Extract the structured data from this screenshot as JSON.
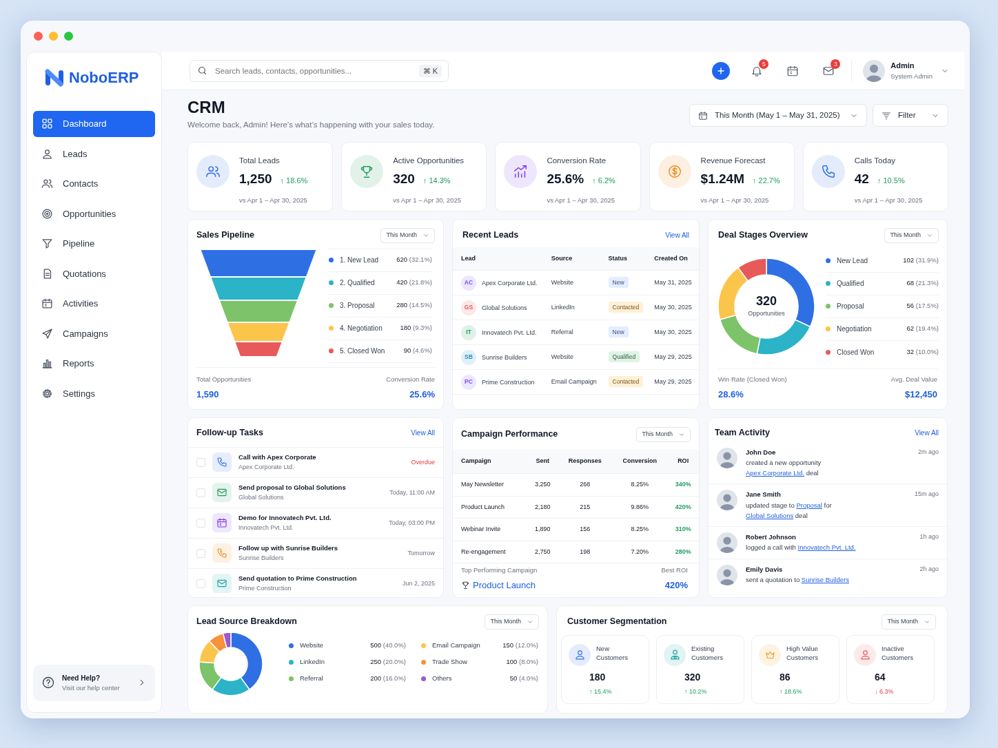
{
  "brand": {
    "name": "NoboERP"
  },
  "sidebar": {
    "items": [
      {
        "label": "Dashboard",
        "selected": true
      },
      {
        "label": "Leads",
        "selected": false
      },
      {
        "label": "Contacts",
        "selected": false
      },
      {
        "label": "Opportunities",
        "selected": false
      },
      {
        "label": "Pipeline",
        "selected": false
      },
      {
        "label": "Quotations",
        "selected": false
      },
      {
        "label": "Activities",
        "selected": false
      },
      {
        "label": "Campaigns",
        "selected": false
      },
      {
        "label": "Reports",
        "selected": false
      },
      {
        "label": "Settings",
        "selected": false
      }
    ],
    "help": {
      "title": "Need Help?",
      "subtitle": "Visit our help center"
    }
  },
  "search": {
    "placeholder": "Search leads, contacts, opportunities...",
    "shortcut": "⌘ K"
  },
  "header": {
    "notifications": "5",
    "messages": "3",
    "user": {
      "name": "Admin",
      "role": "System Admin"
    }
  },
  "page": {
    "title": "CRM",
    "subtitle": "Welcome back, Admin! Here’s what’s happening with your sales today.",
    "date_range": "This Month (May 1 – May 31, 2025)",
    "filter": "Filter"
  },
  "kpis": [
    {
      "label": "Total Leads",
      "value": "1,250",
      "change": "↑ 18.6%",
      "down": false,
      "period": "vs Apr 1 – Apr 30, 2025",
      "color": "#2f6fe4"
    },
    {
      "label": "Active Opportunities",
      "value": "320",
      "change": "↑ 14.3%",
      "down": false,
      "period": "vs Apr 1 – Apr 30, 2025",
      "color": "#1f9d5c"
    },
    {
      "label": "Conversion Rate",
      "value": "25.6%",
      "change": "↑ 6.2%",
      "down": false,
      "period": "vs Apr 1 – Apr 30, 2025",
      "color": "#7c3aed"
    },
    {
      "label": "Revenue Forecast",
      "value": "$1.24M",
      "change": "↑ 22.7%",
      "down": false,
      "period": "vs Apr 1 – Apr 30, 2025",
      "color": "#f08c1a"
    },
    {
      "label": "Calls Today",
      "value": "42",
      "change": "↑ 10.5%",
      "down": false,
      "period": "vs Apr 1 – Apr 30, 2025",
      "color": "#2f6fe4"
    }
  ],
  "sales_pipeline": {
    "title": "Sales Pipeline",
    "period": "This Month",
    "stages": [
      {
        "label": "1. New Lead",
        "value": "620",
        "share": "(32.1%)",
        "color": "#2f6fe4"
      },
      {
        "label": "2. Qualified",
        "value": "420",
        "share": "(21.8%)",
        "color": "#2bb3c8"
      },
      {
        "label": "3. Proposal",
        "value": "280",
        "share": "(14.5%)",
        "color": "#7cc36a"
      },
      {
        "label": "4. Negotiation",
        "value": "180",
        "share": "(9.3%)",
        "color": "#fbc54c"
      },
      {
        "label": "5. Closed Won",
        "value": "90",
        "share": "(4.6%)",
        "color": "#e85a5a"
      }
    ],
    "total_label": "Total Opportunities",
    "total": "1,590",
    "rate_label": "Conversion Rate",
    "rate": "25.6%"
  },
  "recent_leads": {
    "title": "Recent Leads",
    "view_all": "View All",
    "columns": [
      "Lead",
      "Source",
      "Status",
      "Created On"
    ],
    "rows": [
      {
        "initials": "AC",
        "color": "#7c4dff",
        "lead": "Apex Corporate Ltd.",
        "source": "Website",
        "status": {
          "label": "New",
          "color": "#e3edff"
        },
        "created": "May 31, 2025"
      },
      {
        "initials": "GS",
        "color": "#e85a5a",
        "lead": "Global Solutions",
        "source": "LinkedIn",
        "status": {
          "label": "Contacted",
          "color": "#fdf0d5"
        },
        "created": "May 30, 2025"
      },
      {
        "initials": "IT",
        "color": "#1f9d5c",
        "lead": "Innovatech Pvt. Ltd.",
        "source": "Referral",
        "status": {
          "label": "New",
          "color": "#e3edff"
        },
        "created": "May 30, 2025"
      },
      {
        "initials": "SB",
        "color": "#2a8fc8",
        "lead": "Sunrise Builders",
        "source": "Website",
        "status": {
          "label": "Qualified",
          "color": "#dff3e6"
        },
        "created": "May 29, 2025"
      },
      {
        "initials": "PC",
        "color": "#7c4dff",
        "lead": "Prime Construction",
        "source": "Email Campaign",
        "status": {
          "label": "Contacted",
          "color": "#fdf0d5"
        },
        "created": "May 29, 2025"
      }
    ]
  },
  "deal_stages": {
    "title": "Deal Stages Overview",
    "period": "This Month",
    "center_value": "320",
    "center_label": "Opportunities",
    "chart_data": {
      "type": "donut",
      "values": [
        31.9,
        21.3,
        17.5,
        19.4,
        10.0
      ]
    },
    "legend": [
      {
        "label": "New Lead",
        "value": "102",
        "share": "(31.9%)",
        "color": "#2f6fe4"
      },
      {
        "label": "Qualified",
        "value": "68",
        "share": "(21.3%)",
        "color": "#2bb3c8"
      },
      {
        "label": "Proposal",
        "value": "56",
        "share": "(17.5%)",
        "color": "#7cc36a"
      },
      {
        "label": "Negotiation",
        "value": "62",
        "share": "(19.4%)",
        "color": "#fbc54c"
      },
      {
        "label": "Closed Won",
        "value": "32",
        "share": "(10.0%)",
        "color": "#e85a5a"
      }
    ],
    "win_label": "Win Rate (Closed Won)",
    "win": "28.6%",
    "avg_label": "Avg. Deal Value",
    "avg": "$12,450"
  },
  "tasks": {
    "title": "Follow-up Tasks",
    "view_all": "View All",
    "items": [
      {
        "kind": "call",
        "title": "Call with Apex Corporate",
        "company": "Apex Corporate Ltd.",
        "due": "Overdue",
        "overdue": true,
        "checked": false,
        "color": "#2f6fe4"
      },
      {
        "kind": "email",
        "title": "Send proposal to Global Solutions",
        "company": "Global Solutions",
        "due": "Today, 11:00 AM",
        "overdue": false,
        "checked": false,
        "color": "#1f9d5c"
      },
      {
        "kind": "meeting",
        "title": "Demo for Innovatech Pvt. Ltd.",
        "company": "Innovatech Pvt. Ltd.",
        "due": "Today, 03:00 PM",
        "overdue": false,
        "checked": false,
        "color": "#7c3aed"
      },
      {
        "kind": "call",
        "title": "Follow up with Sunrise Builders",
        "company": "Sunrise Builders",
        "due": "Tomorrow",
        "overdue": false,
        "checked": false,
        "color": "#f08c1a"
      },
      {
        "kind": "email",
        "title": "Send quotation to Prime Construction",
        "company": "Prime Construction",
        "due": "Jun 2, 2025",
        "overdue": false,
        "checked": false,
        "color": "#1aa3a3"
      }
    ]
  },
  "campaigns": {
    "title": "Campaign Performance",
    "period": "This Month",
    "columns": [
      "Campaign",
      "Sent",
      "Responses",
      "Conversion",
      "ROI"
    ],
    "rows": [
      [
        "May Newsletter",
        "3,250",
        "268",
        "8.25%",
        "340%"
      ],
      [
        "Product Launch",
        "2,180",
        "215",
        "9.86%",
        "420%"
      ],
      [
        "Webinar Invite",
        "1,890",
        "156",
        "8.25%",
        "310%"
      ],
      [
        "Re-engagement",
        "2,750",
        "198",
        "7.20%",
        "280%"
      ]
    ],
    "top_label": "Top Performing Campaign",
    "top": "Product Launch",
    "roi_label": "Best ROI",
    "roi": "420%"
  },
  "team": {
    "title": "Team Activity",
    "view_all": "View All",
    "items": [
      {
        "name": "John Doe",
        "time": "2m ago",
        "parts": [
          {
            "text": "created a new opportunity ",
            "link": false
          },
          {
            "text": "Apex Corporate Ltd.",
            "link": true
          },
          {
            "text": " deal",
            "link": false
          }
        ]
      },
      {
        "name": "Jane Smith",
        "time": "15m ago",
        "parts": [
          {
            "text": "updated stage to ",
            "link": false
          },
          {
            "text": "Proposal",
            "link": true
          },
          {
            "text": " for ",
            "link": false
          },
          {
            "text": "Global Solutions",
            "link": true
          },
          {
            "text": " deal",
            "link": false
          }
        ]
      },
      {
        "name": "Robert Johnson",
        "time": "1h ago",
        "parts": [
          {
            "text": "logged a call with ",
            "link": false
          },
          {
            "text": "Innovatech Pvt. Ltd.",
            "link": true
          }
        ]
      },
      {
        "name": "Emily Davis",
        "time": "2h ago",
        "parts": [
          {
            "text": "sent a quotation to ",
            "link": false
          },
          {
            "text": "Sunrise Builders",
            "link": true
          }
        ]
      }
    ]
  },
  "lead_sources": {
    "title": "Lead Source Breakdown",
    "period": "This Month",
    "chart_data": {
      "type": "donut",
      "values": [
        40.0,
        20.0,
        16.0,
        12.0,
        8.0,
        4.0
      ]
    },
    "legend": [
      {
        "label": "Website",
        "value": "500",
        "share": "(40.0%)",
        "color": "#2f6fe4"
      },
      {
        "label": "LinkedIn",
        "value": "250",
        "share": "(20.0%)",
        "color": "#2bb3c8"
      },
      {
        "label": "Referral",
        "value": "200",
        "share": "(16.0%)",
        "color": "#7cc36a"
      },
      {
        "label": "Email Campaign",
        "value": "150",
        "share": "(12.0%)",
        "color": "#fbc54c"
      },
      {
        "label": "Trade Show",
        "value": "100",
        "share": "(8.0%)",
        "color": "#f7913a"
      },
      {
        "label": "Others",
        "value": "50",
        "share": "(4.0%)",
        "color": "#9b59d0"
      }
    ]
  },
  "segments": {
    "title": "Customer Segmentation",
    "period": "This Month",
    "items": [
      {
        "label": "New Customers",
        "value": "180",
        "change": "↑ 15.4%",
        "down": false,
        "color": "#2f6fe4"
      },
      {
        "label": "Existing Customers",
        "value": "320",
        "change": "↑ 10.2%",
        "down": false,
        "color": "#1aa3a3"
      },
      {
        "label": "High Value Customers",
        "value": "86",
        "change": "↑ 18.6%",
        "down": false,
        "color": "#f0a020"
      },
      {
        "label": "Inactive Customers",
        "value": "64",
        "change": "↓ 6.3%",
        "down": true,
        "color": "#e85a5a"
      }
    ]
  }
}
